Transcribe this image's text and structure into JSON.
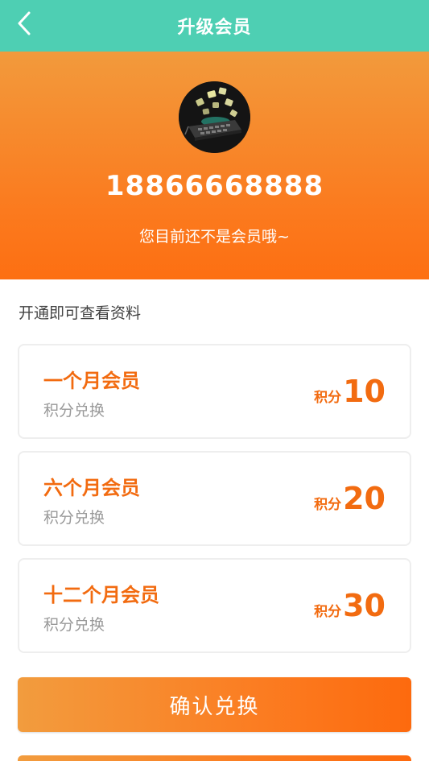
{
  "nav": {
    "title": "升级会员",
    "back_icon": "chevron-left-icon"
  },
  "profile": {
    "avatar_icon": "keyboard-avatar-icon",
    "phone": "18866668888",
    "status": "您目前还不是会员哦~"
  },
  "hint": "开通即可查看资料",
  "plans": [
    {
      "name": "一个月会员",
      "sub": "积分兑换",
      "unit": "积分",
      "points": "10"
    },
    {
      "name": "六个月会员",
      "sub": "积分兑换",
      "unit": "积分",
      "points": "20"
    },
    {
      "name": "十二个月会员",
      "sub": "积分兑换",
      "unit": "积分",
      "points": "30"
    }
  ],
  "confirm_label": "确认兑换",
  "colors": {
    "nav_bg": "#4ecfb3",
    "accent": "#f26b10",
    "gradient_start": "#f29c3e",
    "gradient_end": "#fd6a0e"
  }
}
